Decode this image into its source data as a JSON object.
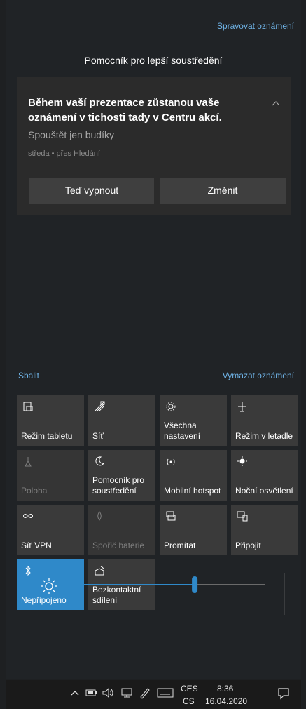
{
  "header": {
    "manage_link": "Spravovat oznámení",
    "group_title": "Pomocník pro lepší soustředění"
  },
  "notification": {
    "title": "Během vaší prezentace zůstanou vaše oznámení v tichosti tady v Centru akcí.",
    "subtitle": "Spouštět jen budíky",
    "meta": "středa • přes Hledání",
    "buttons": [
      "Teď vypnout",
      "Změnit"
    ]
  },
  "actions": {
    "collapse": "Sbalit",
    "clear": "Vymazat oznámení"
  },
  "tiles": [
    {
      "label": "Režim tabletu",
      "icon": "tablet-mode-icon",
      "state": "normal"
    },
    {
      "label": "Síť",
      "icon": "network-icon",
      "state": "normal"
    },
    {
      "label": "Všechna nastavení",
      "icon": "settings-gear-icon",
      "state": "normal"
    },
    {
      "label": "Režim v letadle",
      "icon": "airplane-icon",
      "state": "normal"
    },
    {
      "label": "Poloha",
      "icon": "location-icon",
      "state": "disabled"
    },
    {
      "label": "Pomocník pro soustředění",
      "icon": "moon-icon",
      "state": "normal"
    },
    {
      "label": "Mobilní hotspot",
      "icon": "hotspot-icon",
      "state": "normal"
    },
    {
      "label": "Noční osvětlení",
      "icon": "night-light-icon",
      "state": "normal"
    },
    {
      "label": "Síť VPN",
      "icon": "vpn-icon",
      "state": "normal"
    },
    {
      "label": "Spořič baterie",
      "icon": "battery-saver-icon",
      "state": "disabled"
    },
    {
      "label": "Promítat",
      "icon": "project-icon",
      "state": "normal"
    },
    {
      "label": "Připojit",
      "icon": "connect-icon",
      "state": "normal"
    },
    {
      "label": "Nepřipojeno",
      "icon": "bluetooth-icon",
      "state": "active"
    },
    {
      "label": "Bezkontaktní sdílení",
      "icon": "nearby-sharing-icon",
      "state": "normal"
    }
  ],
  "brightness": {
    "value_percent": 63,
    "icon": "brightness-icon"
  },
  "taskbar": {
    "lang_top": "CES",
    "lang_bottom": "CS",
    "time": "8:36",
    "date": "16.04.2020"
  },
  "colors": {
    "accent": "#2f89c9",
    "link": "#6fb3e6"
  }
}
